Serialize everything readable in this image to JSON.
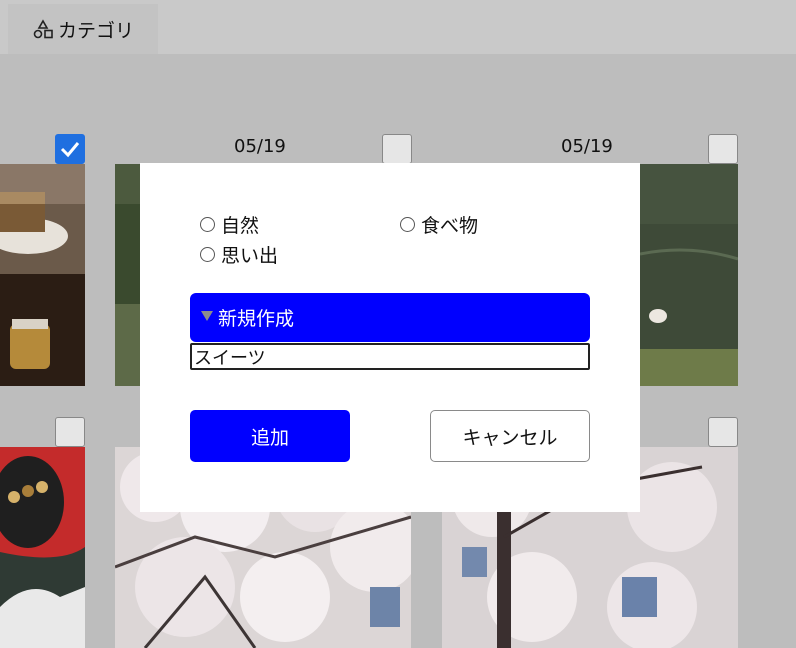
{
  "header": {
    "tab_label": "カテゴリ",
    "tab_icon": "category-shapes-icon"
  },
  "grid": {
    "dates": [
      "05/19",
      "05/19"
    ],
    "checkboxes": [
      {
        "checked": true
      },
      {
        "checked": false
      },
      {
        "checked": false
      },
      {
        "checked": false
      },
      {
        "checked": false
      }
    ]
  },
  "dialog": {
    "categories": [
      {
        "label": "自然"
      },
      {
        "label": "食べ物"
      },
      {
        "label": "思い出"
      }
    ],
    "new_section_label": "新規作成",
    "new_name_value": "スイーツ",
    "add_label": "追加",
    "cancel_label": "キャンセル"
  },
  "colors": {
    "primary": "#0000ff",
    "checked": "#1f6fe0",
    "backdrop": "#bdbdbd"
  }
}
